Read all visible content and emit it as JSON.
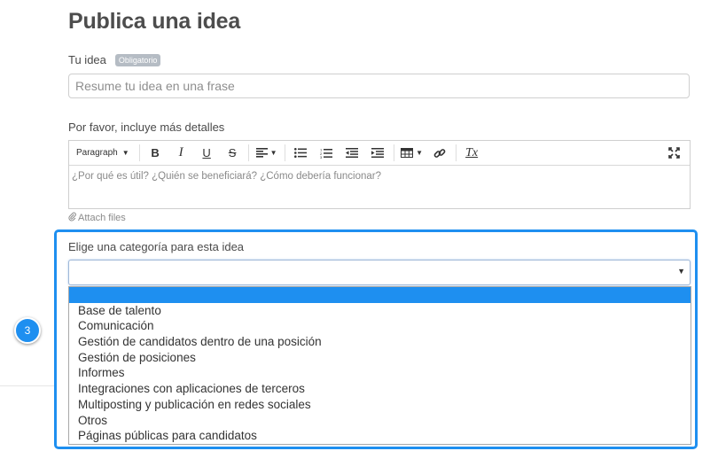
{
  "page": {
    "title": "Publica una idea"
  },
  "idea": {
    "label": "Tu idea",
    "badge": "Obligatorio",
    "placeholder": "Resume tu idea en una frase"
  },
  "details": {
    "label": "Por favor, incluye más detalles",
    "placeholder": "¿Por qué es útil? ¿Quién se beneficiará? ¿Cómo debería funcionar?",
    "toolbar": {
      "paragraph": "Paragraph",
      "bold": "B",
      "italic": "I",
      "underline": "U",
      "strikethrough": "S",
      "clear_format": "Tx"
    },
    "attach": "Attach files"
  },
  "category": {
    "label": "Elige una categoría para esta idea",
    "selected": "",
    "options": [
      "",
      "Base de talento",
      "Comunicación",
      "Gestión de candidatos dentro de una posición",
      "Gestión de posiciones",
      "Informes",
      "Integraciones con aplicaciones de terceros",
      "Multiposting y publicación en redes sociales",
      "Otros",
      "Páginas públicas para candidatos"
    ]
  },
  "step": {
    "number": "3"
  },
  "colors": {
    "accent": "#1e8ff0",
    "badge": "#b5bcc4"
  }
}
